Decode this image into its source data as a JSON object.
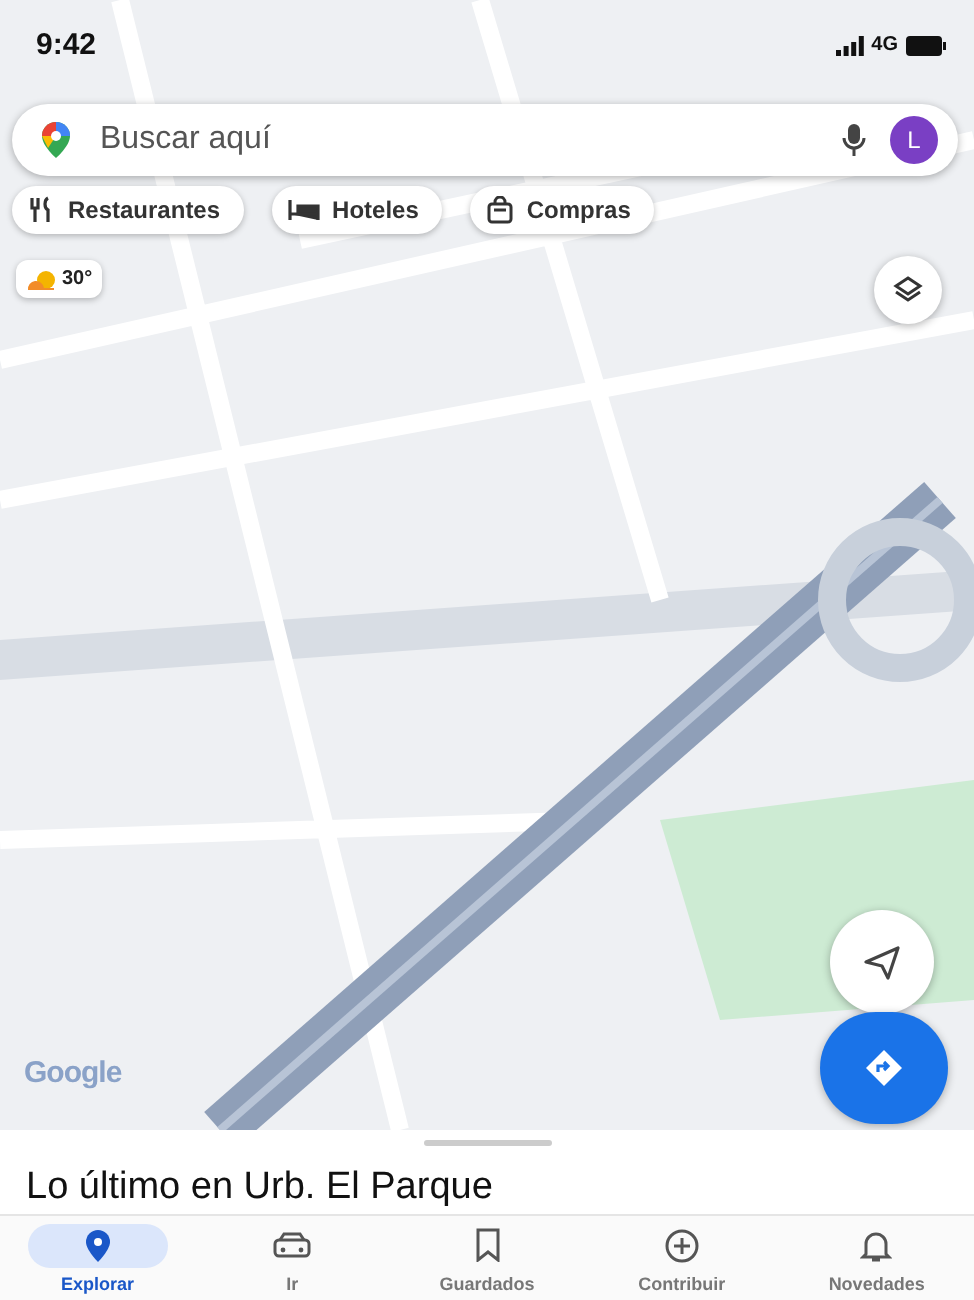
{
  "status_bar": {
    "time": "9:42",
    "network": "4G"
  },
  "search": {
    "placeholder": "Buscar aquí",
    "avatar": "L"
  },
  "chips": [
    {
      "label": "Restaurantes",
      "kind": "food"
    },
    {
      "label": "Hoteles",
      "kind": "hotel"
    },
    {
      "label": "Compras",
      "kind": "shopping"
    }
  ],
  "weather": {
    "temperature": "30°"
  },
  "map": {
    "attribution": "Google"
  },
  "sheet": {
    "title": "Lo último en Urb. El Parque"
  },
  "nav": [
    {
      "label": "Explorar",
      "kind": "explore",
      "selected": true
    },
    {
      "label": "Ir",
      "kind": "go",
      "selected": false
    },
    {
      "label": "Guardados",
      "kind": "saved",
      "selected": false
    },
    {
      "label": "Contribuir",
      "kind": "contribute",
      "selected": false
    },
    {
      "label": "Novedades",
      "kind": "updates",
      "selected": false
    }
  ]
}
